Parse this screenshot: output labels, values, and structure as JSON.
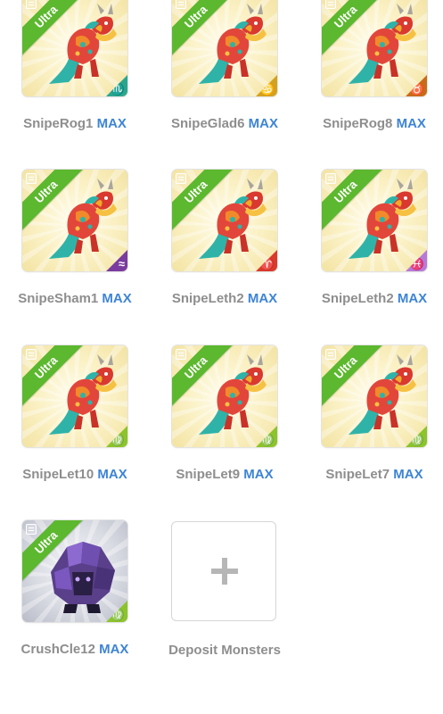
{
  "tier_label": "Ultra",
  "max_label": "MAX",
  "colors": {
    "ribbon": "#5cb82e",
    "name_text": "#8e8e8e",
    "max_text": "#3d84d6",
    "scorpio": "#2aa68f",
    "cancer": "#d4a11e",
    "taurus": "#c96a1a",
    "aquarius": "#7a3b9e",
    "aries": "#d93a2b",
    "pisces": "#b879d6",
    "virgo": "#8cc42a"
  },
  "monsters": [
    {
      "name": "SnipeRog1",
      "sign_icon": "scorpio-icon",
      "sign_glyph": "♏",
      "sign_color": "#2aa68f",
      "art": "dragon"
    },
    {
      "name": "SnipeGlad6",
      "sign_icon": "cancer-icon",
      "sign_glyph": "♋",
      "sign_color": "#d4a11e",
      "art": "dragon"
    },
    {
      "name": "SnipeRog8",
      "sign_icon": "taurus-icon",
      "sign_glyph": "♉",
      "sign_color": "#c96a1a",
      "art": "dragon"
    },
    {
      "name": "SnipeSham1",
      "sign_icon": "aquarius-icon",
      "sign_glyph": "≈",
      "sign_color": "#7a3b9e",
      "art": "dragon"
    },
    {
      "name": "SnipeLeth2",
      "sign_icon": "aries-icon",
      "sign_glyph": "♈",
      "sign_color": "#d93a2b",
      "art": "dragon"
    },
    {
      "name": "SnipeLeth2",
      "sign_icon": "pisces-icon",
      "sign_glyph": "♓",
      "sign_color": "#b879d6",
      "art": "dragon"
    },
    {
      "name": "SnipeLet10",
      "sign_icon": "virgo-icon",
      "sign_glyph": "♍",
      "sign_color": "#8cc42a",
      "art": "dragon"
    },
    {
      "name": "SnipeLet9",
      "sign_icon": "virgo-icon",
      "sign_glyph": "♍",
      "sign_color": "#8cc42a",
      "art": "dragon"
    },
    {
      "name": "SnipeLet7",
      "sign_icon": "virgo-icon",
      "sign_glyph": "♍",
      "sign_color": "#8cc42a",
      "art": "dragon"
    },
    {
      "name": "CrushCle12",
      "sign_icon": "virgo-icon",
      "sign_glyph": "♍",
      "sign_color": "#8cc42a",
      "art": "golem"
    }
  ],
  "deposit": {
    "label": "Deposit Monsters",
    "icon": "plus-icon"
  }
}
